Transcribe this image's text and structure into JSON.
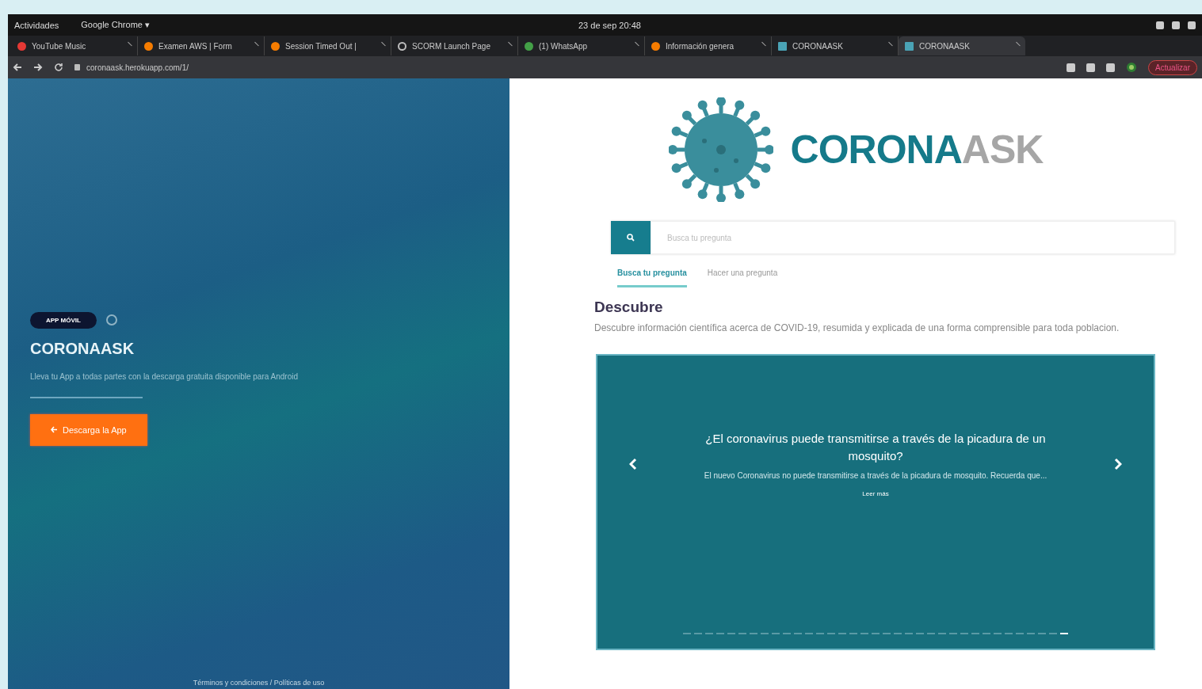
{
  "system_bar": {
    "activities": "Actividades",
    "app_menu": "Google Chrome ▾",
    "clock": "23 de sep 20:48"
  },
  "browser": {
    "tabs": [
      {
        "title": "YouTube Music",
        "kind": "dot",
        "color": "#e53935",
        "selected": false
      },
      {
        "title": "Examen AWS | Form",
        "kind": "dot",
        "color": "#f57c00",
        "selected": false
      },
      {
        "title": "Session Timed Out |",
        "kind": "dot",
        "color": "#f57c00",
        "selected": false
      },
      {
        "title": "SCORM Launch Page",
        "kind": "globe",
        "color": "#bdbdbd",
        "selected": false
      },
      {
        "title": "(1) WhatsApp",
        "kind": "dot",
        "color": "#43a047",
        "selected": false
      },
      {
        "title": "Información genera",
        "kind": "dot",
        "color": "#f57c00",
        "selected": false
      },
      {
        "title": "CORONAASK",
        "kind": "grid",
        "color": "#4aa3b5",
        "selected": false
      },
      {
        "title": "CORONAASK",
        "kind": "grid",
        "color": "#4aa3b5",
        "selected": true
      }
    ],
    "url": "coronaask.herokuapp.com/1/",
    "update_button": "Actualizar"
  },
  "promo": {
    "badge": "APP MÓVIL",
    "title": "CORONAASK",
    "description": "Lleva tu App a todas partes con la descarga gratuita disponible para Android",
    "button": "Descarga la App",
    "footer": "Términos y condiciones / Políticas de uso"
  },
  "main": {
    "logo": {
      "part_1": "CORONA",
      "part_2": "ASK"
    },
    "search": {
      "placeholder": "Busca tu pregunta"
    },
    "tabs": [
      {
        "label": "Busca tu pregunta",
        "selected": true
      },
      {
        "label": "Hacer una pregunta",
        "selected": false
      }
    ],
    "section_title": "Descubre",
    "section_text": "Descubre información científica acerca de COVID-19, resumida y explicada de una forma comprensible para toda poblacion.",
    "carousel": {
      "title": "¿El coronavirus puede transmitirse a través de la picadura de un mosquito?",
      "text": "El nuevo Coronavirus no puede transmitirse a través de la picadura de mosquito. Recuerda que...",
      "link": "Leer más",
      "indicators": [
        {
          "selected": false
        },
        {
          "selected": false
        },
        {
          "selected": false
        },
        {
          "selected": false
        },
        {
          "selected": false
        },
        {
          "selected": false
        },
        {
          "selected": false
        },
        {
          "selected": false
        },
        {
          "selected": false
        },
        {
          "selected": false
        },
        {
          "selected": false
        },
        {
          "selected": false
        },
        {
          "selected": false
        },
        {
          "selected": false
        },
        {
          "selected": false
        },
        {
          "selected": false
        },
        {
          "selected": false
        },
        {
          "selected": false
        },
        {
          "selected": false
        },
        {
          "selected": false
        },
        {
          "selected": false
        },
        {
          "selected": false
        },
        {
          "selected": false
        },
        {
          "selected": false
        },
        {
          "selected": false
        },
        {
          "selected": false
        },
        {
          "selected": false
        },
        {
          "selected": false
        },
        {
          "selected": false
        },
        {
          "selected": false
        },
        {
          "selected": false
        },
        {
          "selected": false
        },
        {
          "selected": false
        },
        {
          "selected": false
        },
        {
          "selected": true
        }
      ]
    }
  }
}
